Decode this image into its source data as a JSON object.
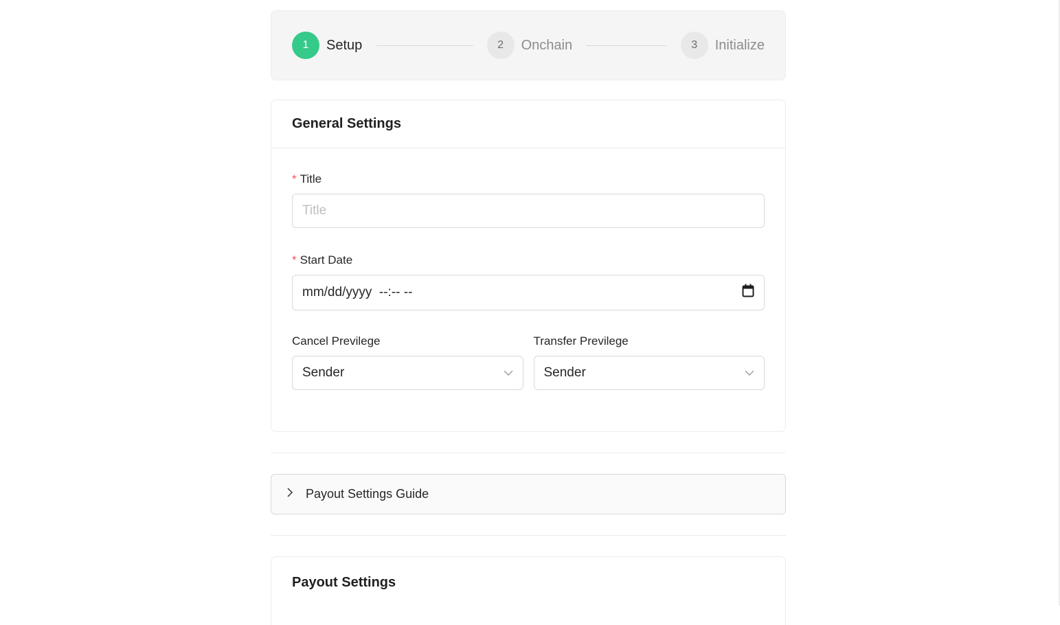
{
  "steps": [
    {
      "number": "1",
      "label": "Setup",
      "state": "active"
    },
    {
      "number": "2",
      "label": "Onchain",
      "state": "pending"
    },
    {
      "number": "3",
      "label": "Initialize",
      "state": "pending"
    }
  ],
  "general": {
    "title": "General Settings",
    "title_field": {
      "label": "Title",
      "placeholder": "Title",
      "value": ""
    },
    "start_date": {
      "label": "Start Date",
      "value": "mm/dd/yyyy  --:-- --",
      "icon": "calendar-icon"
    },
    "cancel": {
      "label": "Cancel Previlege",
      "value": "Sender"
    },
    "transfer": {
      "label": "Transfer Previlege",
      "value": "Sender"
    }
  },
  "guide": {
    "label": "Payout Settings Guide",
    "icon": "chevron-right-icon"
  },
  "payout": {
    "title": "Payout Settings"
  },
  "colors": {
    "accent": "#35c98a",
    "required": "#ff4d4f"
  }
}
